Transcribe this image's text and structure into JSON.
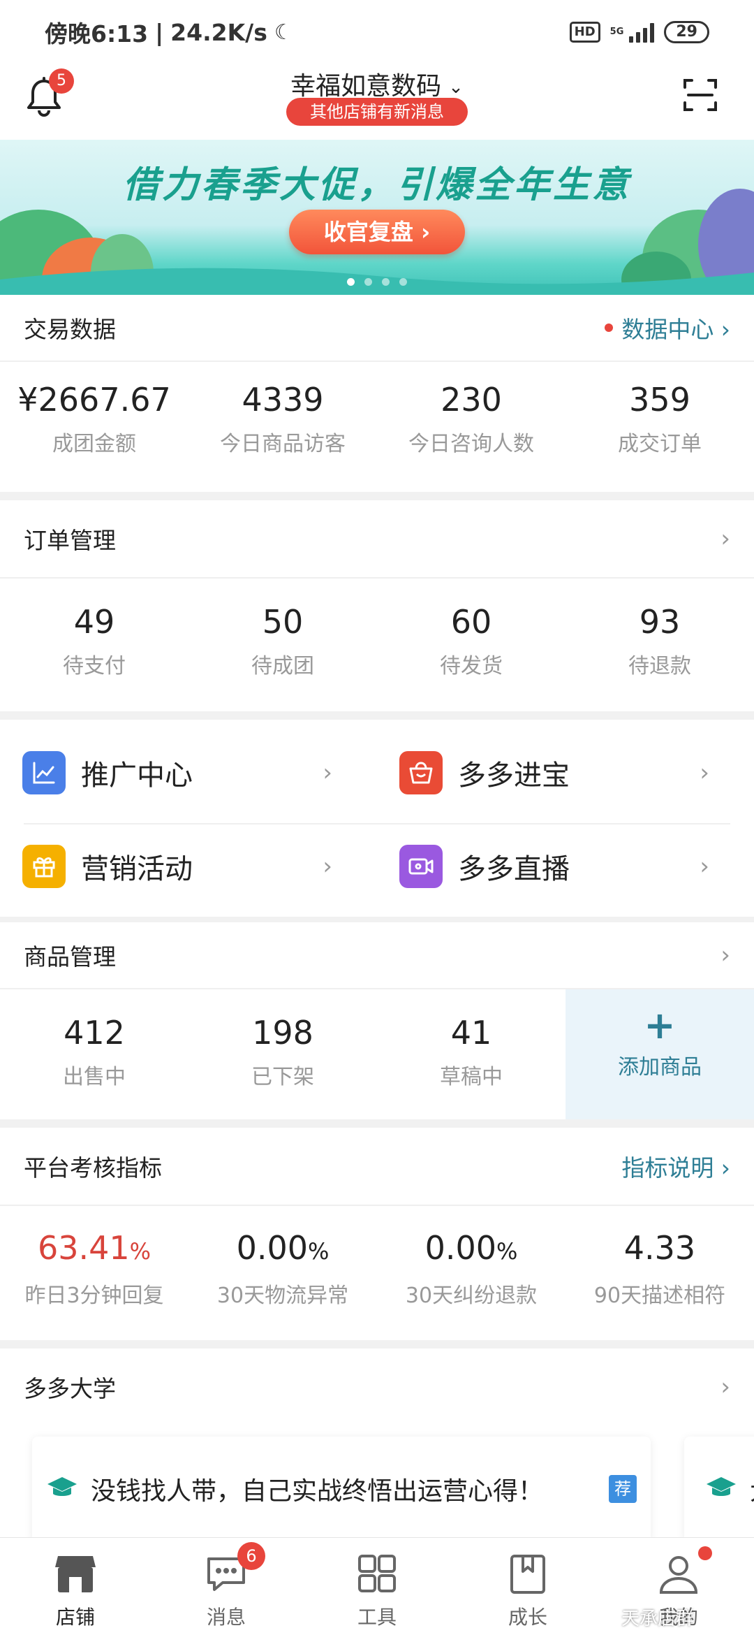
{
  "status_bar": {
    "time": "傍晚6:13",
    "speed": "24.2K/s",
    "network": "5G",
    "hd": "HD",
    "battery": "29"
  },
  "header": {
    "shop_name": "幸福如意数码",
    "notice": "其他店铺有新消息",
    "bell_badge": "5"
  },
  "banner": {
    "title": "借力春季大促，引爆全年生意",
    "button": "收官复盘 ›"
  },
  "trade": {
    "title": "交易数据",
    "link": "数据中心 ›",
    "items": [
      {
        "value": "¥2667.67",
        "label": "成团金额"
      },
      {
        "value": "4339",
        "label": "今日商品访客"
      },
      {
        "value": "230",
        "label": "今日咨询人数"
      },
      {
        "value": "359",
        "label": "成交订单"
      }
    ]
  },
  "orders": {
    "title": "订单管理",
    "items": [
      {
        "value": "49",
        "label": "待支付"
      },
      {
        "value": "50",
        "label": "待成团"
      },
      {
        "value": "60",
        "label": "待发货"
      },
      {
        "value": "93",
        "label": "待退款"
      }
    ]
  },
  "shortcuts": [
    {
      "label": "推广中心",
      "color": "#4a7fe8"
    },
    {
      "label": "多多进宝",
      "color": "#e94b35"
    },
    {
      "label": "营销活动",
      "color": "#f5b000"
    },
    {
      "label": "多多直播",
      "color": "#9a59e0"
    }
  ],
  "goods": {
    "title": "商品管理",
    "items": [
      {
        "value": "412",
        "label": "出售中"
      },
      {
        "value": "198",
        "label": "已下架"
      },
      {
        "value": "41",
        "label": "草稿中"
      }
    ],
    "add": {
      "plus": "+",
      "label": "添加商品"
    }
  },
  "metrics": {
    "title": "平台考核指标",
    "link": "指标说明 ›",
    "items": [
      {
        "value": "63.41",
        "unit": "%",
        "label": "昨日3分钟回复"
      },
      {
        "value": "0.00",
        "unit": "%",
        "label": "30天物流异常"
      },
      {
        "value": "0.00",
        "unit": "%",
        "label": "30天纠纷退款"
      },
      {
        "value": "4.33",
        "unit": "",
        "label": "90天描述相符"
      }
    ]
  },
  "university": {
    "title": "多多大学",
    "card_text": "没钱找人带，自己实战终悟出运营心得！",
    "tag": "荐",
    "card2_text": "大"
  },
  "tabs": [
    {
      "label": "店铺",
      "icon": "shop-icon"
    },
    {
      "label": "消息",
      "icon": "message-icon",
      "badge": "6"
    },
    {
      "label": "工具",
      "icon": "tools-icon"
    },
    {
      "label": "成长",
      "icon": "bookmark-icon"
    },
    {
      "label": "我的",
      "icon": "profile-icon"
    }
  ],
  "watermark": "天承店群",
  "colors": {
    "accent": "#2e7e95",
    "alert": "#e8453c",
    "brand_green": "#19a08e"
  }
}
